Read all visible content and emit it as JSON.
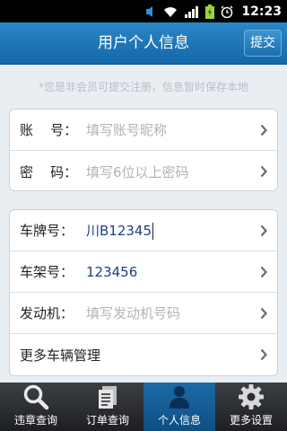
{
  "status_bar": {
    "time": "12:23"
  },
  "header": {
    "title": "用户个人信息",
    "submit_label": "提交"
  },
  "notice": "*您是非会员可提交注册，信息暂时保存本地",
  "account_group": {
    "rows": [
      {
        "label": "账    号：",
        "placeholder": "填写账号昵称"
      },
      {
        "label": "密    码：",
        "placeholder": "填写6位以上密码"
      }
    ]
  },
  "vehicle_group": {
    "rows": [
      {
        "label": "车牌号：",
        "value": "川B12345"
      },
      {
        "label": "车架号：",
        "value": "123456"
      },
      {
        "label": "发动机：",
        "placeholder": "填写发动机号码"
      },
      {
        "label": "更多车辆管理"
      }
    ]
  },
  "tabs": [
    {
      "label": "违章查询",
      "icon": "search-icon",
      "active": false
    },
    {
      "label": "订单查询",
      "icon": "order-list-icon",
      "active": false
    },
    {
      "label": "个人信息",
      "icon": "person-icon",
      "active": true
    },
    {
      "label": "更多设置",
      "icon": "gear-icon",
      "active": false
    }
  ],
  "colors": {
    "header": "#1a74b6",
    "active_tab": "#1c6aa6",
    "filled_value": "#1c3f8a"
  }
}
